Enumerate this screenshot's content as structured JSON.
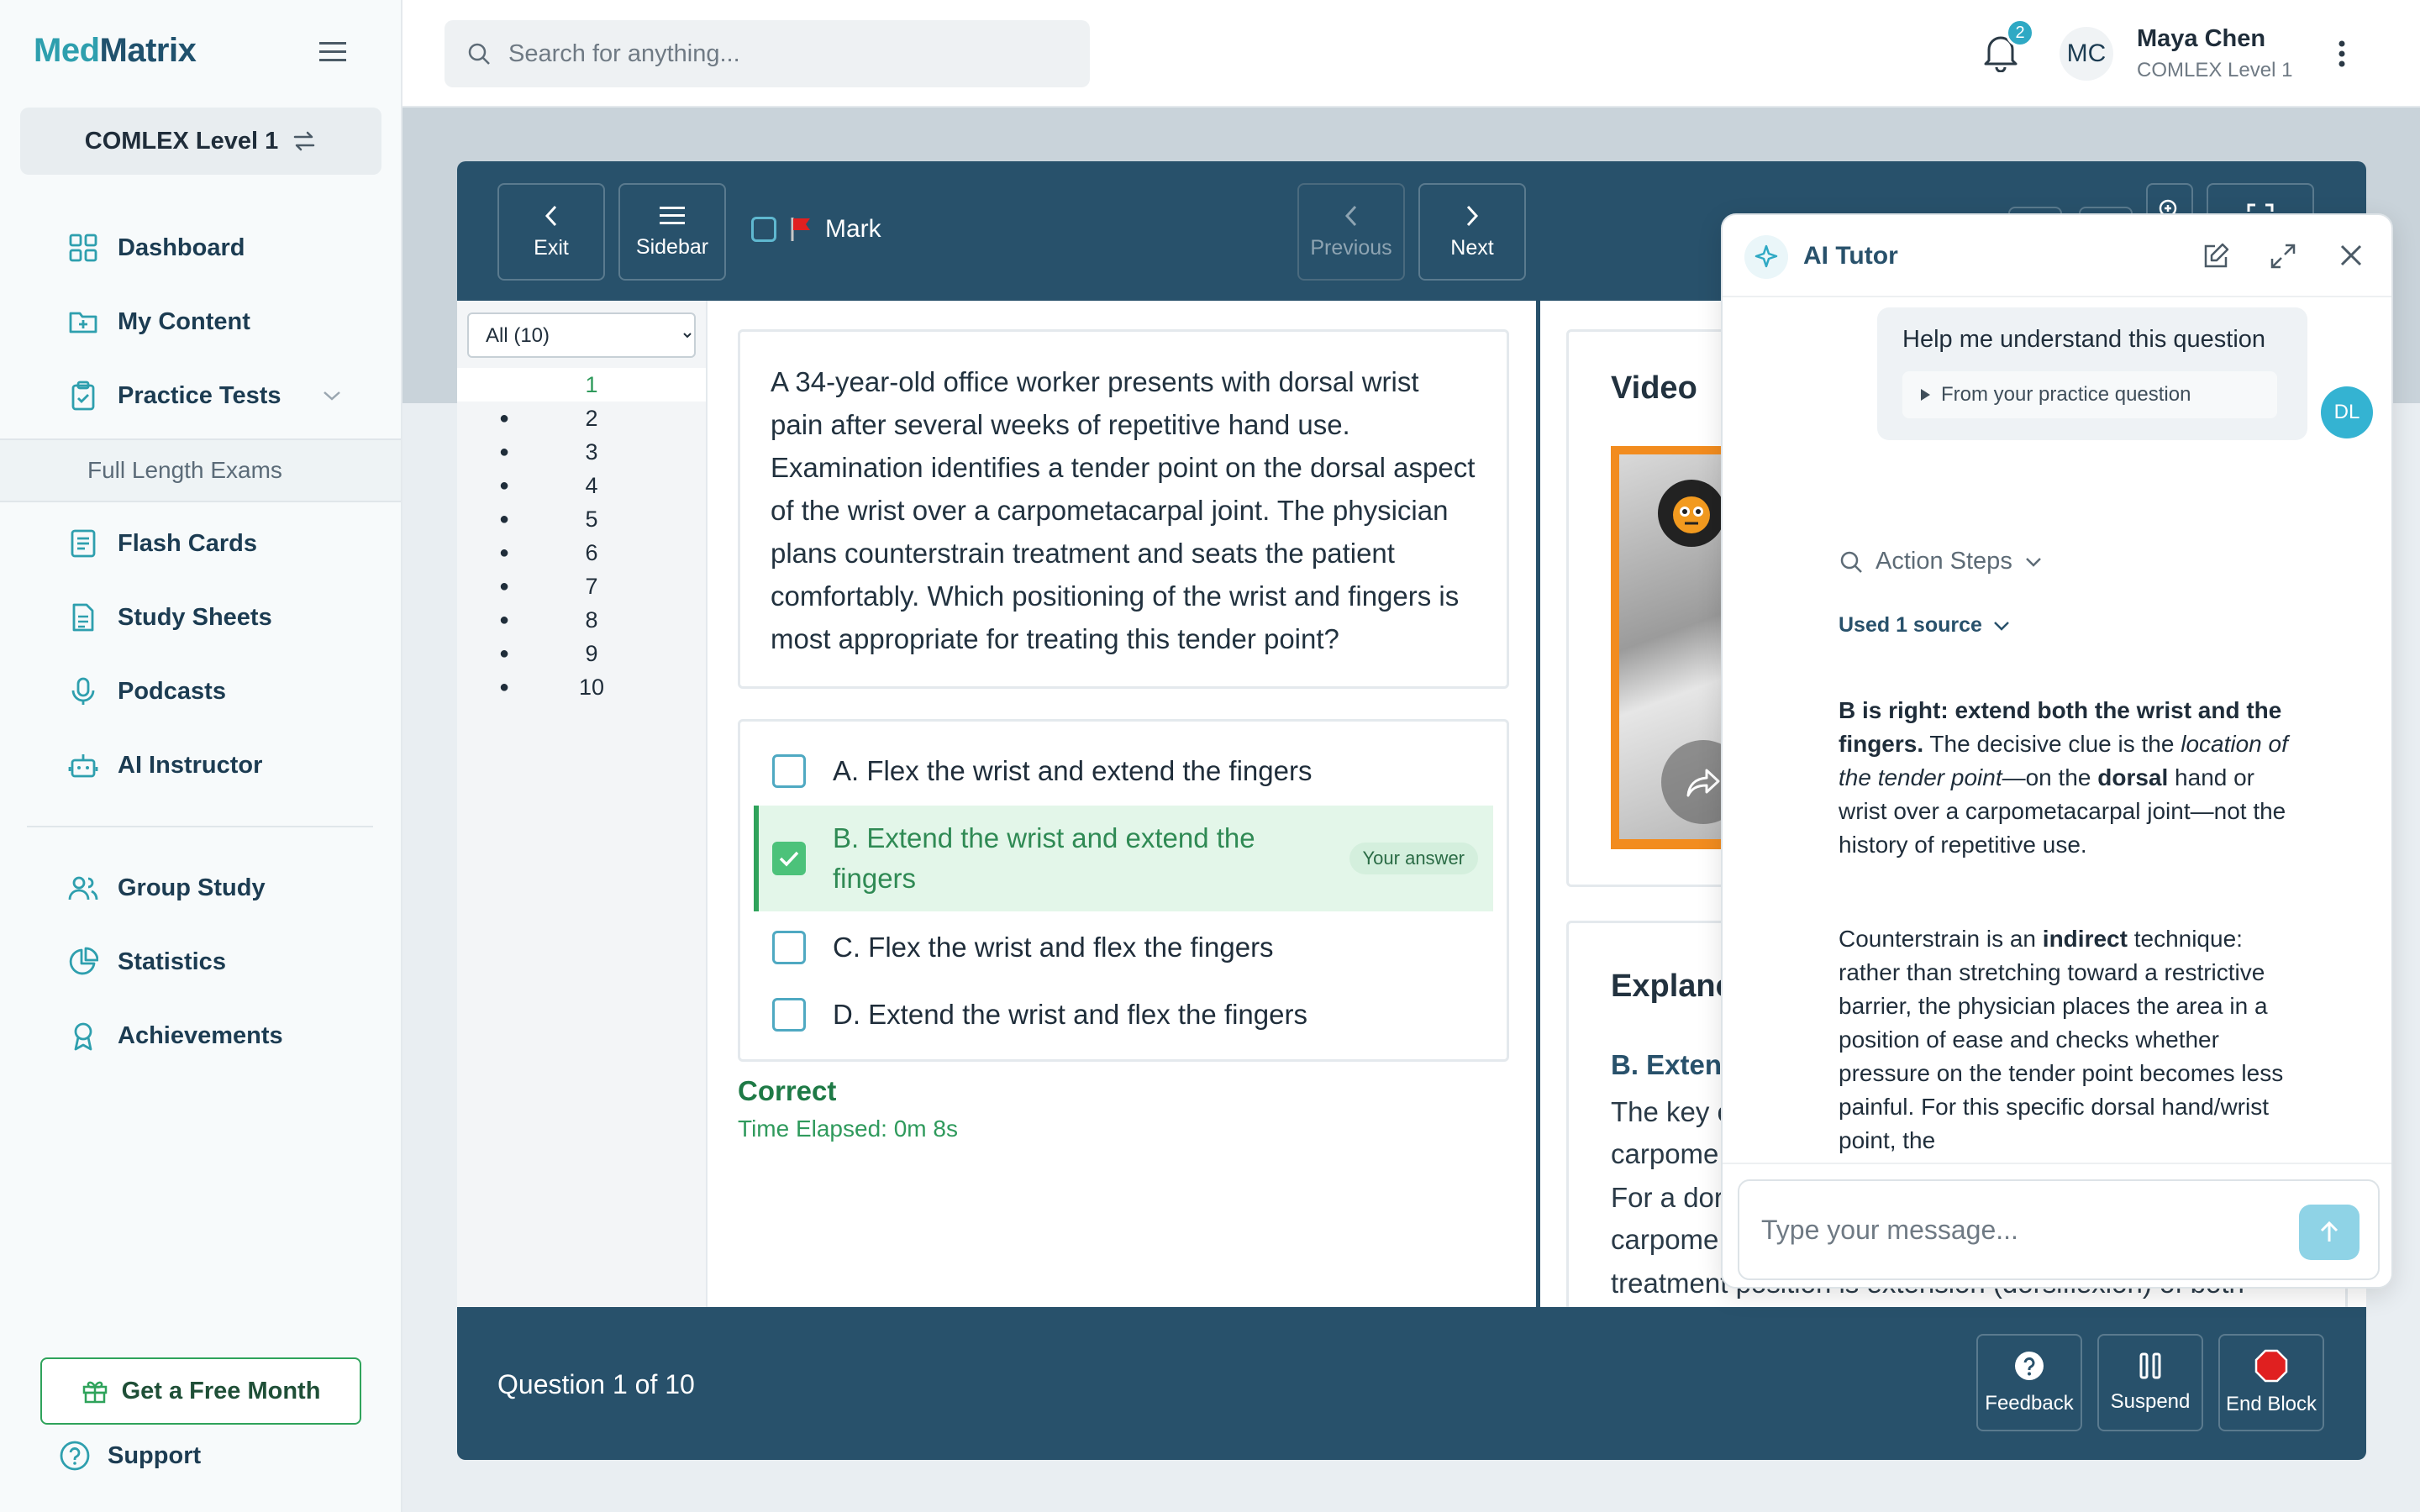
{
  "app": {
    "logo_a": "Med",
    "logo_b": "Matrix"
  },
  "sidebar": {
    "exam_switch": "COMLEX Level 1",
    "items": [
      {
        "label": "Dashboard",
        "icon": "grid-icon"
      },
      {
        "label": "My Content",
        "icon": "folder-plus-icon"
      },
      {
        "label": "Practice Tests",
        "icon": "clipboard-icon"
      },
      {
        "label": "Flash Cards",
        "icon": "cards-icon"
      },
      {
        "label": "Study Sheets",
        "icon": "document-icon"
      },
      {
        "label": "Podcasts",
        "icon": "microphone-icon"
      },
      {
        "label": "AI Instructor",
        "icon": "robot-icon"
      },
      {
        "label": "Group Study",
        "icon": "users-icon"
      },
      {
        "label": "Statistics",
        "icon": "pie-chart-icon"
      },
      {
        "label": "Achievements",
        "icon": "award-icon"
      }
    ],
    "sub_item": "Full Length Exams",
    "free_month": "Get a Free Month",
    "support": "Support"
  },
  "topbar": {
    "search_placeholder": "Search for anything...",
    "notifications_count": "2",
    "user_initials": "MC",
    "user_name": "Maya Chen",
    "user_exam": "COMLEX Level 1"
  },
  "exam": {
    "toolbar": {
      "exit": "Exit",
      "sidebar": "Sidebar",
      "mark": "Mark",
      "previous": "Previous",
      "next": "Next"
    },
    "filter": "All (10)",
    "questions": [
      "1",
      "2",
      "3",
      "4",
      "5",
      "6",
      "7",
      "8",
      "9",
      "10"
    ],
    "stem": "A 34-year-old office worker presents with dorsal wrist pain after several weeks of repetitive hand use. Examination identifies a tender point on the dorsal aspect of the wrist over a carpometacarpal joint. The physician plans counterstrain treatment and seats the patient comfortably. Which positioning of the wrist and fingers is most appropriate for treating this tender point?",
    "answers": [
      {
        "text": "A. Flex the wrist and extend the fingers"
      },
      {
        "text": "B. Extend the wrist and extend the fingers",
        "badge": "Your answer"
      },
      {
        "text": "C. Flex the wrist and flex the fingers"
      },
      {
        "text": "D. Extend the wrist and flex the fingers"
      }
    ],
    "result": "Correct",
    "elapsed": "Time Elapsed: 0m 8s",
    "video_title": "Video",
    "explanation_title": "Explanc",
    "explanation_sub": "B. Exten",
    "explanation_lines": [
      "The key c",
      "carpome",
      "For a dor",
      "carpome",
      "treatment position is extension (dorsiflexion) of both"
    ],
    "footer": {
      "counter": "Question 1 of 10",
      "feedback": "Feedback",
      "suspend": "Suspend",
      "end_block": "End Block"
    }
  },
  "tutor": {
    "title": "AI Tutor",
    "user_message": "Help me understand this question",
    "source_chip": "From your practice question",
    "user_avatar": "DL",
    "action_steps": "Action Steps",
    "used_source": "Used 1 source",
    "p1_bold": "B is right: extend both the wrist and the fingers.",
    "p1_a": " The decisive clue is the ",
    "p1_italic": "location of the tender point",
    "p1_b": "—on the ",
    "p1_bold2": "dorsal",
    "p1_c": " hand or wrist over a carpometacarpal joint—not the history of repetitive use.",
    "p2_a": "Counterstrain is an ",
    "p2_bold": "indirect",
    "p2_b": " technique: rather than stretching toward a restrictive barrier, the physician places the area in a position of ease and checks whether pressure on the tender point becomes less painful. For this specific dorsal hand/wrist point, the",
    "input_placeholder": "Type your message..."
  },
  "colors": {
    "brand_dark": "#28516b",
    "brand_teal": "#2e9fae",
    "success": "#2fa35b",
    "accent_red": "#e02020"
  }
}
